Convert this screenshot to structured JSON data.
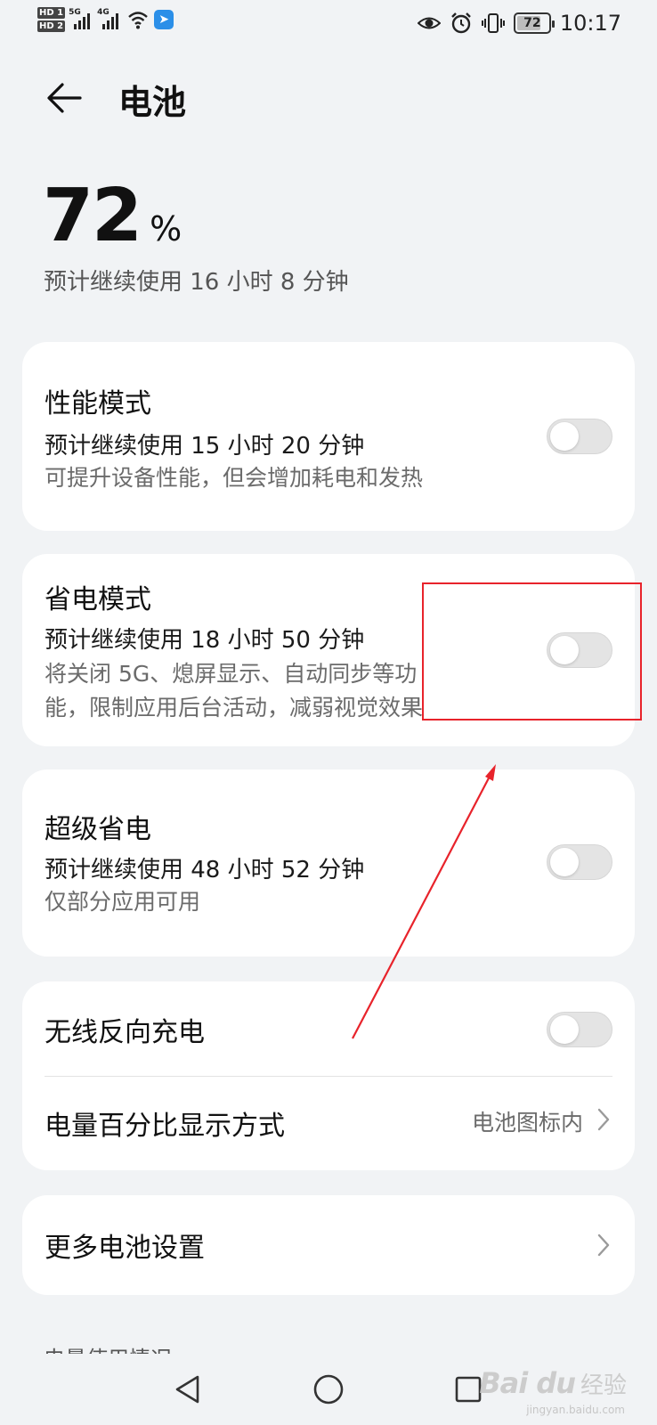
{
  "status_bar": {
    "hd1": "HD 1",
    "hd2": "HD 2",
    "net1": "5G",
    "net2": "4G",
    "battery_level": "72",
    "time": "10:17"
  },
  "header": {
    "title": "电池"
  },
  "battery": {
    "percent_value": "72",
    "percent_unit": "%",
    "estimate": "预计继续使用 16 小时 8 分钟"
  },
  "modes": {
    "performance": {
      "title": "性能模式",
      "estimate": "预计继续使用 15 小时 20 分钟",
      "desc": "可提升设备性能，但会增加耗电和发热",
      "enabled": false
    },
    "power_saving": {
      "title": "省电模式",
      "estimate": "预计继续使用 18 小时 50 分钟",
      "desc_line1": "将关闭 5G、熄屏显示、自动同步等功",
      "desc_line2": "能，限制应用后台活动，减弱视觉效果",
      "enabled": false
    },
    "ultra": {
      "title": "超级省电",
      "estimate": "预计继续使用 48 小时 52 分钟",
      "desc": "仅部分应用可用",
      "enabled": false
    }
  },
  "settings": {
    "wireless_reverse": {
      "title": "无线反向充电",
      "enabled": false
    },
    "percent_display": {
      "title": "电量百分比显示方式",
      "value": "电池图标内"
    },
    "more": {
      "title": "更多电池设置"
    }
  },
  "usage_section": {
    "label": "电量使用情况"
  },
  "watermark": {
    "logo": "Bai du",
    "text": "经验",
    "sub": "jingyan.baidu.com"
  },
  "colors": {
    "background": "#f1f3f5",
    "card": "#ffffff",
    "annotation": "#e8232b",
    "toggle_off": "#e4e4e4"
  }
}
